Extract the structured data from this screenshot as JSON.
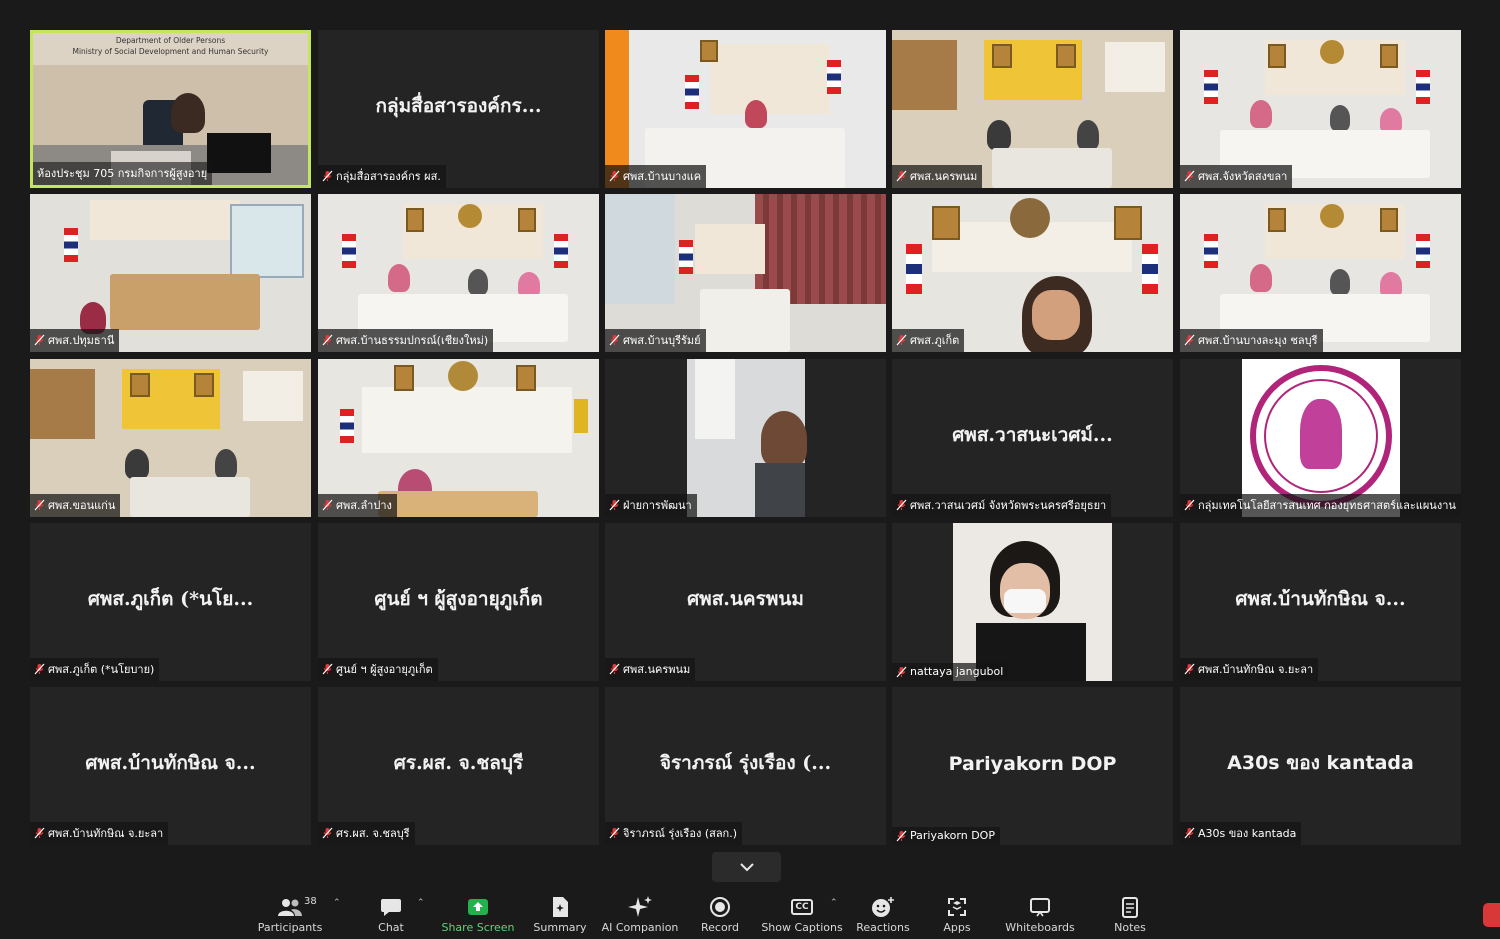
{
  "meeting": {
    "grid_rows": [
      [
        {
          "display": "",
          "label": "ห้องประชุม 705 กรมกิจการผู้สูงอายุ",
          "video": true,
          "scene": "podium",
          "active": true,
          "muted": false,
          "banner_lines": [
            "Department of Older Persons",
            "Ministry of Social Development and Human Security"
          ]
        },
        {
          "display": "กลุ่มสื่อสารองค์กร...",
          "label": "กลุ่มสื่อสารองค์กร ผส.",
          "video": false,
          "muted": true
        },
        {
          "display": "",
          "label": "ศพส.บ้านบางแค",
          "video": true,
          "scene": "office-solo",
          "muted": true
        },
        {
          "display": "",
          "label": "ศพส.นครพนม",
          "video": true,
          "scene": "office-group",
          "muted": true
        },
        {
          "display": "",
          "label": "ศพส.จังหวัดสงขลา",
          "video": true,
          "scene": "conference",
          "muted": true
        }
      ],
      [
        {
          "display": "",
          "label": "ศพส.ปทุมธานี",
          "video": true,
          "scene": "meeting-window",
          "muted": true
        },
        {
          "display": "",
          "label": "ศพส.บ้านธรรมปกรณ์(เชียงใหม่)",
          "video": true,
          "scene": "conference",
          "muted": true
        },
        {
          "display": "",
          "label": "ศพส.บ้านบุรีรัมย์",
          "video": true,
          "scene": "curtain",
          "muted": true
        },
        {
          "display": "",
          "label": "ศพส.ภูเก็ต",
          "video": true,
          "scene": "closeup",
          "muted": true
        },
        {
          "display": "",
          "label": "ศพส.บ้านบางละมุง ชลบุรี",
          "video": true,
          "scene": "conference",
          "muted": true
        }
      ],
      [
        {
          "display": "",
          "label": "ศพส.ขอนแก่น",
          "video": true,
          "scene": "office-group",
          "muted": true
        },
        {
          "display": "",
          "label": "ศพส.ลำปาง",
          "video": true,
          "scene": "sign-board",
          "muted": true
        },
        {
          "display": "",
          "label": "ฝ่ายการพัฒนา",
          "video": true,
          "scene": "portrait-narrow",
          "muted": true
        },
        {
          "display": "ศพส.วาสนะเวศม์...",
          "label": "ศพส.วาสนเวศม์ จังหวัดพระนครศรีอยุธยา",
          "video": false,
          "muted": true
        },
        {
          "display": "",
          "label": "กลุ่มเทคโนโลยีสารสนเทศ กองยุทธศาสตร์และแผนงาน",
          "video": true,
          "scene": "emblem",
          "muted": true
        }
      ],
      [
        {
          "display": "ศพส.ภูเก็ต (*นโย...",
          "label": "ศพส.ภูเก็ต (*นโยบาย)",
          "video": false,
          "muted": true
        },
        {
          "display": "ศูนย์ ฯ ผู้สูงอายุภูเก็ต",
          "label": "ศูนย์ ฯ ผู้สูงอายุภูเก็ต",
          "video": false,
          "muted": true
        },
        {
          "display": "ศพส.นครพนม",
          "label": "ศพส.นครพนม",
          "video": false,
          "muted": true
        },
        {
          "display": "",
          "label": "nattaya jangubol",
          "video": true,
          "scene": "portrait-mask",
          "muted": true
        },
        {
          "display": "ศพส.บ้านทักษิณ จ...",
          "label": "ศพส.บ้านทักษิณ จ.ยะลา",
          "video": false,
          "muted": true
        }
      ],
      [
        {
          "display": "ศพส.บ้านทักษิณ จ...",
          "label": "ศพส.บ้านทักษิณ จ.ยะลา",
          "video": false,
          "muted": true
        },
        {
          "display": "ศร.ผส. จ.ชลบุรี",
          "label": "ศร.ผส. จ.ชลบุรี",
          "video": false,
          "muted": true
        },
        {
          "display": "จิราภรณ์ รุ่งเรือง (...",
          "label": "จิราภรณ์ รุ่งเรือง (สลก.)",
          "video": false,
          "muted": true
        },
        {
          "display": "Pariyakorn DOP",
          "label": "Pariyakorn DOP",
          "video": false,
          "muted": true,
          "latin": true
        },
        {
          "display": "A30s ของ kantada",
          "label": "A30s ของ kantada",
          "video": false,
          "muted": true,
          "latin": true
        }
      ]
    ]
  },
  "toolbar": {
    "participants": {
      "label": "Participants",
      "count": "38",
      "icon": "participants-icon"
    },
    "chat": {
      "label": "Chat",
      "icon": "chat-icon"
    },
    "share": {
      "label": "Share Screen",
      "icon": "share-screen-icon"
    },
    "summary": {
      "label": "Summary",
      "icon": "summary-icon"
    },
    "ai": {
      "label": "AI Companion",
      "icon": "sparkle-icon"
    },
    "record": {
      "label": "Record",
      "icon": "record-icon"
    },
    "captions": {
      "label": "Show Captions",
      "icon": "captions-icon",
      "cc": "CC"
    },
    "reactions": {
      "label": "Reactions",
      "icon": "reactions-icon"
    },
    "apps": {
      "label": "Apps",
      "icon": "apps-icon"
    },
    "whiteboards": {
      "label": "Whiteboards",
      "icon": "whiteboard-icon"
    },
    "notes": {
      "label": "Notes",
      "icon": "notes-icon"
    }
  },
  "colors": {
    "accent_border": "#c4e65d",
    "share_green": "#23b14d",
    "mute_red": "#e03a3a"
  }
}
